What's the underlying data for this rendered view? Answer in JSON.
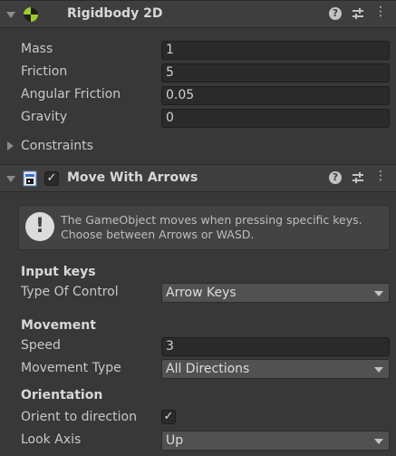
{
  "rigidbody": {
    "title": "Rigidbody 2D",
    "mass_label": "Mass",
    "mass_value": "1",
    "friction_label": "Friction",
    "friction_value": "5",
    "angular_friction_label": "Angular Friction",
    "angular_friction_value": "0.05",
    "gravity_label": "Gravity",
    "gravity_value": "0",
    "constraints_label": "Constraints"
  },
  "move": {
    "title": "Move With Arrows",
    "enabled": true,
    "help_line1": "The GameObject moves when pressing specific keys.",
    "help_line2": "Choose between Arrows or WASD.",
    "input_keys_header": "Input keys",
    "type_of_control_label": "Type Of Control",
    "type_of_control_value": "Arrow Keys",
    "movement_header": "Movement",
    "speed_label": "Speed",
    "speed_value": "3",
    "movement_type_label": "Movement Type",
    "movement_type_value": "All Directions",
    "orientation_header": "Orientation",
    "orient_label": "Orient to direction",
    "orient_checked": true,
    "look_axis_label": "Look Axis",
    "look_axis_value": "Up"
  },
  "icons": [
    "foldout-arrow",
    "rigidbody-icon",
    "help-icon",
    "preset-icon",
    "context-menu-icon",
    "script-icon",
    "warning-icon",
    "checkmark-icon",
    "dropdown-arrow"
  ],
  "colors": {
    "background": "#383838",
    "header": "#3e3e3e",
    "field": "#2a2a2a",
    "dropdown": "#515151",
    "text": "#c8c8c8"
  }
}
